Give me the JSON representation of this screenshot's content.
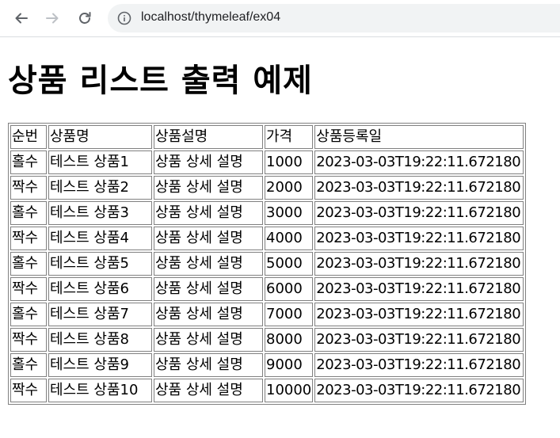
{
  "browser": {
    "url": "localhost/thymeleaf/ex04"
  },
  "page": {
    "title": "상품 리스트 출력 예제"
  },
  "table": {
    "headers": [
      "순번",
      "상품명",
      "상품설명",
      "가격",
      "상품등록일"
    ],
    "rows": [
      [
        "홀수",
        "테스트 상품1",
        "상품 상세 설명",
        "1000",
        "2023-03-03T19:22:11.672180"
      ],
      [
        "짝수",
        "테스트 상품2",
        "상품 상세 설명",
        "2000",
        "2023-03-03T19:22:11.672180"
      ],
      [
        "홀수",
        "테스트 상품3",
        "상품 상세 설명",
        "3000",
        "2023-03-03T19:22:11.672180"
      ],
      [
        "짝수",
        "테스트 상품4",
        "상품 상세 설명",
        "4000",
        "2023-03-03T19:22:11.672180"
      ],
      [
        "홀수",
        "테스트 상품5",
        "상품 상세 설명",
        "5000",
        "2023-03-03T19:22:11.672180"
      ],
      [
        "짝수",
        "테스트 상품6",
        "상품 상세 설명",
        "6000",
        "2023-03-03T19:22:11.672180"
      ],
      [
        "홀수",
        "테스트 상품7",
        "상품 상세 설명",
        "7000",
        "2023-03-03T19:22:11.672180"
      ],
      [
        "짝수",
        "테스트 상품8",
        "상품 상세 설명",
        "8000",
        "2023-03-03T19:22:11.672180"
      ],
      [
        "홀수",
        "테스트 상품9",
        "상품 상세 설명",
        "9000",
        "2023-03-03T19:22:11.672180"
      ],
      [
        "짝수",
        "테스트 상품10",
        "상품 상세 설명",
        "10000",
        "2023-03-03T19:22:11.672180"
      ]
    ]
  },
  "icons": {
    "back": "arrow-left-icon",
    "forward": "arrow-right-icon",
    "reload": "reload-icon",
    "site_info": "info-icon"
  },
  "colors": {
    "omnibox_bg": "#f1f3f4",
    "table_border": "#808080"
  }
}
